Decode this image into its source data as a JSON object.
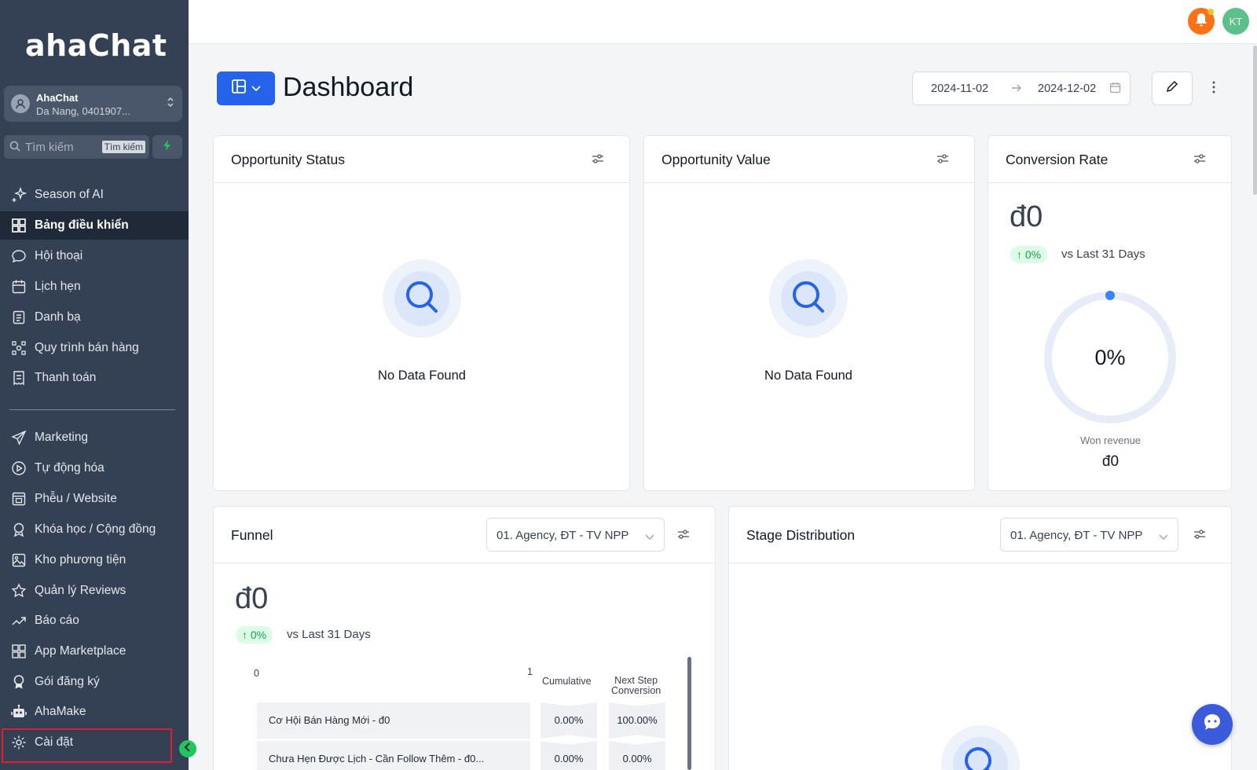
{
  "brand": {
    "logo_text": "ahaChat"
  },
  "account": {
    "name": "AhaChat",
    "subtitle": "Da Nang, 0401907..."
  },
  "search": {
    "placeholder": "Tìm kiếm",
    "shortcut": "Tìm kiếm"
  },
  "sidebar": {
    "items": [
      {
        "label": "Season of AI",
        "icon": "sparkle-icon"
      },
      {
        "label": "Bảng điều khiển",
        "icon": "dashboard-grid-icon",
        "active": true
      },
      {
        "label": "Hội thoại",
        "icon": "chat-bubble-icon"
      },
      {
        "label": "Lịch hẹn",
        "icon": "calendar-icon"
      },
      {
        "label": "Danh bạ",
        "icon": "contacts-icon"
      },
      {
        "label": "Quy trình bán hàng",
        "icon": "pipeline-icon"
      },
      {
        "label": "Thanh toán",
        "icon": "invoice-icon"
      },
      {
        "label": "Marketing",
        "icon": "send-icon"
      },
      {
        "label": "Tự động hóa",
        "icon": "automation-icon"
      },
      {
        "label": "Phễu / Website",
        "icon": "website-icon"
      },
      {
        "label": "Khóa học / Cộng đồng",
        "icon": "course-icon"
      },
      {
        "label": "Kho phương tiện",
        "icon": "image-icon"
      },
      {
        "label": "Quản lý Reviews",
        "icon": "star-icon"
      },
      {
        "label": "Báo cáo",
        "icon": "trend-icon"
      },
      {
        "label": "App Marketplace",
        "icon": "apps-grid-icon"
      },
      {
        "label": "Gói đăng ký",
        "icon": "badge-icon"
      },
      {
        "label": "AhaMake",
        "icon": "robot-icon"
      },
      {
        "label": "Cài đặt",
        "icon": "gear-icon"
      }
    ]
  },
  "topbar": {
    "user_initials": "KT"
  },
  "header": {
    "title": "Dashboard",
    "date_start": "2024-11-02",
    "date_end": "2024-12-02"
  },
  "cards": {
    "opportunity_status": {
      "title": "Opportunity Status",
      "empty": "No Data Found"
    },
    "opportunity_value": {
      "title": "Opportunity Value",
      "empty": "No Data Found"
    },
    "conversion_rate": {
      "title": "Conversion Rate",
      "value": "đ0",
      "change": "↑ 0%",
      "vs": "vs Last 31 Days",
      "gauge_label": "0%",
      "gauge_value": 0,
      "won_label": "Won revenue",
      "won_value": "đ0"
    },
    "funnel": {
      "title": "Funnel",
      "pipeline": "01. Agency, ĐT - TV NPP",
      "value": "đ0",
      "change": "↑ 0%",
      "vs": "vs Last 31 Days",
      "axis_min": "0",
      "axis_max": "1",
      "col_cumulative": "Cumulative",
      "col_next_line1": "Next Step",
      "col_next_line2": "Conversion",
      "rows": [
        {
          "label": "Cơ Hội Bán Hàng Mới - đ0",
          "cumulative": "0.00%",
          "next": "100.00%"
        },
        {
          "label": "Chưa Hẹn Được Lịch - Cần Follow Thêm - đ0...",
          "cumulative": "0.00%",
          "next": "0.00%"
        }
      ]
    },
    "stage_distribution": {
      "title": "Stage Distribution",
      "pipeline": "01. Agency, ĐT - TV NPP"
    }
  },
  "colors": {
    "sidebar_bg": "#344155",
    "accent": "#2563eb",
    "success": "#22c55e",
    "notification": "#f97316",
    "highlight_border": "#e11d2e"
  }
}
